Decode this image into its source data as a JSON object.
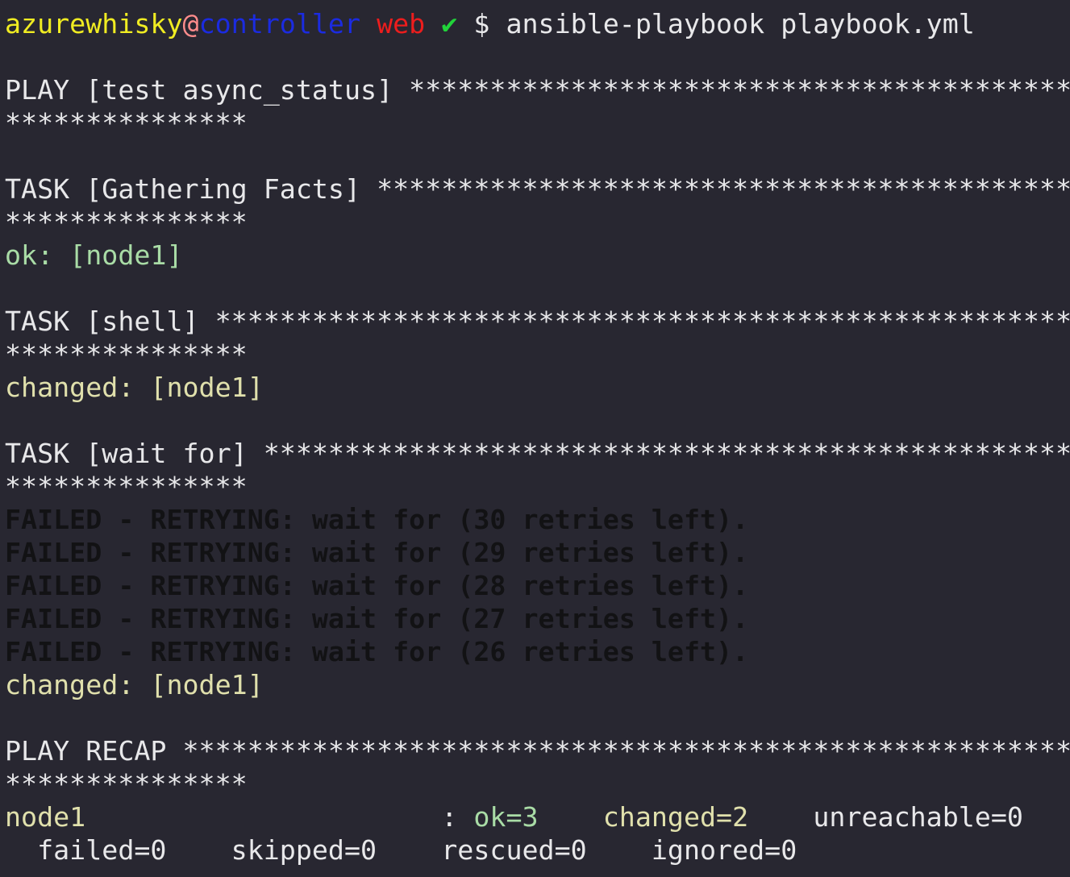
{
  "prompt": {
    "user": "azurewhisky",
    "at": "@",
    "host": "controller",
    "branch": "web",
    "check": "✔",
    "symbol": "$",
    "command": "ansible-playbook playbook.yml"
  },
  "colors": {
    "background": "#282731",
    "user": "#f0ec22",
    "host": "#1b2be0",
    "branch": "#ec1d1d",
    "check": "#21d33a",
    "ok": "#a9dca6",
    "changed": "#e0e0ac",
    "failed": "#121214"
  },
  "output": {
    "play_header": "PLAY [test async_status] ********************************************",
    "play_header_wrap": "***************",
    "task1_header": "TASK [Gathering Facts] **********************************************",
    "task1_header_wrap": "***************",
    "task1_result": "ok: [node1]",
    "task2_header": "TASK [shell] ********************************************************",
    "task2_header_wrap": "***************",
    "task2_result": "changed: [node1]",
    "task3_header": "TASK [wait for] *****************************************************",
    "task3_header_wrap": "***************",
    "retries": [
      "FAILED - RETRYING: wait for (30 retries left).",
      "FAILED - RETRYING: wait for (29 retries left).",
      "FAILED - RETRYING: wait for (28 retries left).",
      "FAILED - RETRYING: wait for (27 retries left).",
      "FAILED - RETRYING: wait for (26 retries left)."
    ],
    "task3_result": "changed: [node1]",
    "recap_header": "PLAY RECAP **********************************************************",
    "recap_header_wrap": "***************",
    "recap": {
      "host": "node1",
      "sep": "                      : ",
      "ok": "ok=3",
      "gap1": "    ",
      "changed": "changed=2",
      "gap2": "    ",
      "unreachable": "unreachable=0",
      "line2": "  failed=0    skipped=0    rescued=0    ignored=0"
    }
  }
}
